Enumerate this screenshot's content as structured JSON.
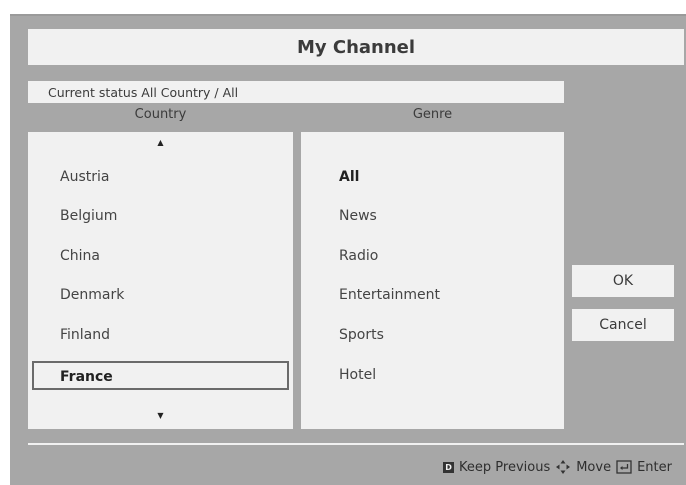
{
  "title": "My Channel",
  "status": "Current status All Country / All",
  "columns": {
    "country": "Country",
    "genre": "Genre"
  },
  "arrows": {
    "up": "▲",
    "down": "▼"
  },
  "country_items": [
    "Austria",
    "Belgium",
    "China",
    "Denmark",
    "Finland",
    "France"
  ],
  "country_selected": "France",
  "genre_items": [
    "All",
    "News",
    "Radio",
    "Entertainment",
    "Sports",
    "Hotel"
  ],
  "genre_active": "All",
  "buttons": {
    "ok": "OK",
    "cancel": "Cancel"
  },
  "footer": {
    "keep_previous_key": "D",
    "keep_previous": "Keep Previous",
    "move": "Move",
    "enter": "Enter"
  },
  "colors": {
    "background": "#a7a7a7",
    "panel": "#f1f1f1",
    "text": "#3b3b3b"
  }
}
